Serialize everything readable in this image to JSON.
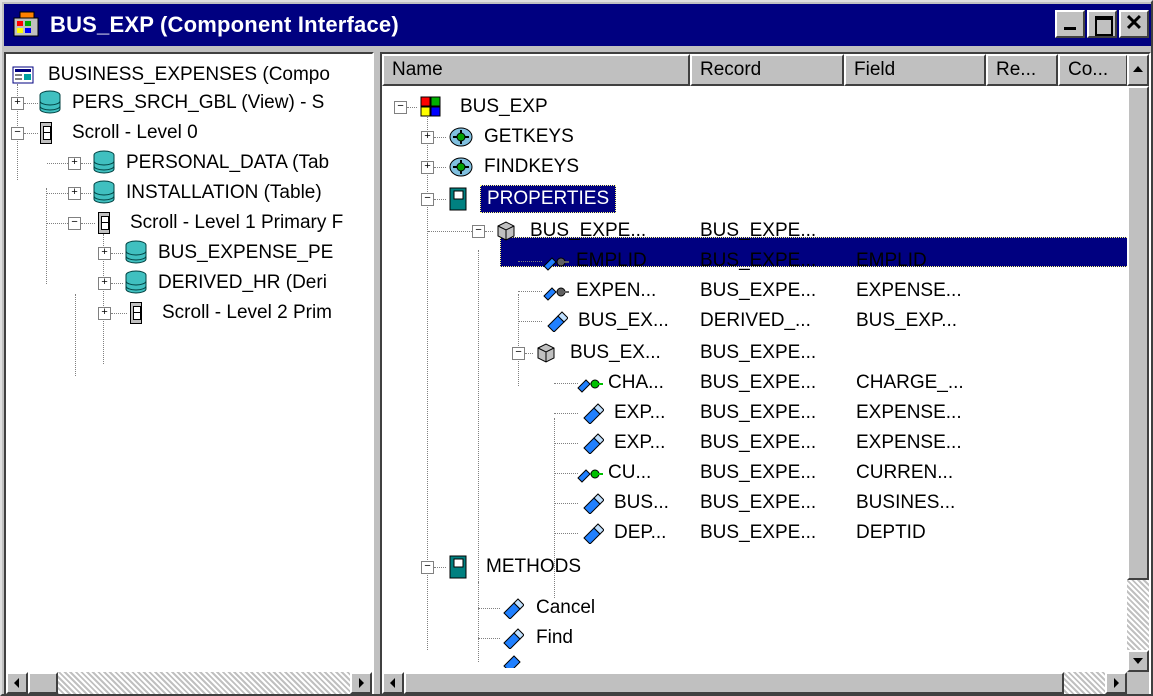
{
  "window": {
    "title": "BUS_EXP (Component Interface)",
    "colors": {
      "titlebar": "#000080",
      "face": "#c0c0c0",
      "selection": "#000080"
    }
  },
  "left_tree": [
    {
      "label": "BUSINESS_EXPENSES (Compo",
      "icon": "component-icon"
    },
    {
      "label": "PERS_SRCH_GBL (View) - S",
      "icon": "database-icon"
    },
    {
      "label": "Scroll - Level 0",
      "icon": "scroll-icon"
    },
    {
      "label": "PERSONAL_DATA (Tab",
      "icon": "database-icon"
    },
    {
      "label": "INSTALLATION (Table)",
      "icon": "database-icon"
    },
    {
      "label": "Scroll - Level 1  Primary F",
      "icon": "scroll-icon"
    },
    {
      "label": "BUS_EXPENSE_PE",
      "icon": "database-icon"
    },
    {
      "label": "DERIVED_HR (Deri",
      "icon": "database-icon"
    },
    {
      "label": "Scroll - Level 2  Prim",
      "icon": "scroll-icon"
    }
  ],
  "columns": [
    "Name",
    "Record",
    "Field",
    "Re...",
    "Co..."
  ],
  "right_tree": [
    {
      "name": "BUS_EXP",
      "record": "",
      "field": "",
      "icon": "component-interface-icon"
    },
    {
      "name": "GETKEYS",
      "record": "",
      "field": "",
      "icon": "keys-icon"
    },
    {
      "name": "FINDKEYS",
      "record": "",
      "field": "",
      "icon": "keys-icon"
    },
    {
      "name": "PROPERTIES",
      "record": "",
      "field": "",
      "icon": "book-icon"
    },
    {
      "name": "BUS_EXPE...",
      "record": "BUS_EXPE...",
      "field": "",
      "icon": "collection-icon"
    },
    {
      "name": "EMPLID",
      "record": "BUS_EXPE...",
      "field": "EMPLID",
      "icon": "key-property-icon"
    },
    {
      "name": "EXPEN...",
      "record": "BUS_EXPE...",
      "field": "EXPENSE...",
      "icon": "key-property-icon"
    },
    {
      "name": "BUS_EX...",
      "record": "DERIVED_...",
      "field": "BUS_EXP...",
      "icon": "property-icon"
    },
    {
      "name": "BUS_EX...",
      "record": "BUS_EXPE...",
      "field": "",
      "icon": "collection-icon"
    },
    {
      "name": "CHA...",
      "record": "BUS_EXPE...",
      "field": "CHARGE_...",
      "icon": "key-property-green-icon"
    },
    {
      "name": "EXP...",
      "record": "BUS_EXPE...",
      "field": "EXPENSE...",
      "icon": "property-icon"
    },
    {
      "name": "EXP...",
      "record": "BUS_EXPE...",
      "field": "EXPENSE...",
      "icon": "property-icon"
    },
    {
      "name": "CU...",
      "record": "BUS_EXPE...",
      "field": "CURREN...",
      "icon": "key-property-green-icon"
    },
    {
      "name": "BUS...",
      "record": "BUS_EXPE...",
      "field": "BUSINES...",
      "icon": "property-icon"
    },
    {
      "name": "DEP...",
      "record": "BUS_EXPE...",
      "field": "DEPTID",
      "icon": "property-icon"
    },
    {
      "name": "METHODS",
      "record": "",
      "field": "",
      "icon": "book-icon"
    },
    {
      "name": "Cancel",
      "record": "",
      "field": "",
      "icon": "method-icon"
    },
    {
      "name": "Find",
      "record": "",
      "field": "",
      "icon": "method-icon"
    }
  ]
}
